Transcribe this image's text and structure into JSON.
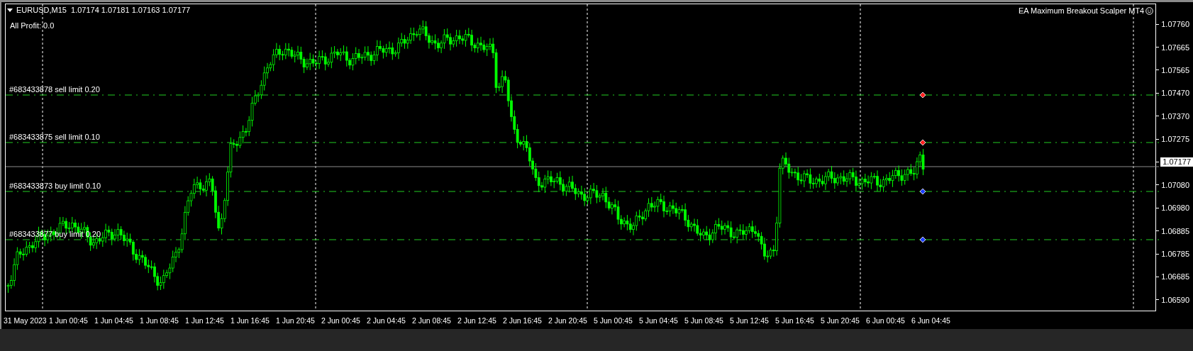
{
  "chart": {
    "symbol_line": "EURUSD,M15  1.07174 1.07181 1.07163 1.07177",
    "profit": "All Profit: 0.0",
    "expert": "EA Maximum Breakout Scalper MT4",
    "current_price": "1.07177",
    "orders": [
      {
        "label": "#683433878 sell limit 0.20",
        "kind": "sell"
      },
      {
        "label": "#683433875 sell limit 0.10",
        "kind": "sell"
      },
      {
        "label": "#683433873 buy limit 0.10",
        "kind": "buy"
      },
      {
        "label": "#683433877 buy limit 0.20",
        "kind": "buy"
      }
    ]
  },
  "price_axis": [
    "1.07760",
    "1.07665",
    "1.07565",
    "1.07470",
    "1.07370",
    "1.07275",
    "1.07080",
    "1.06980",
    "1.06885",
    "1.06785",
    "1.06685",
    "1.06590"
  ],
  "time_axis": [
    "31 May 2023",
    "1 Jun 00:45",
    "1 Jun 04:45",
    "1 Jun 08:45",
    "1 Jun 12:45",
    "1 Jun 16:45",
    "1 Jun 20:45",
    "2 Jun 00:45",
    "2 Jun 04:45",
    "2 Jun 08:45",
    "2 Jun 12:45",
    "2 Jun 16:45",
    "2 Jun 20:45",
    "5 Jun 00:45",
    "5 Jun 04:45",
    "5 Jun 08:45",
    "5 Jun 12:45",
    "5 Jun 16:45",
    "5 Jun 20:45",
    "6 Jun 00:45",
    "6 Jun 04:45"
  ]
}
